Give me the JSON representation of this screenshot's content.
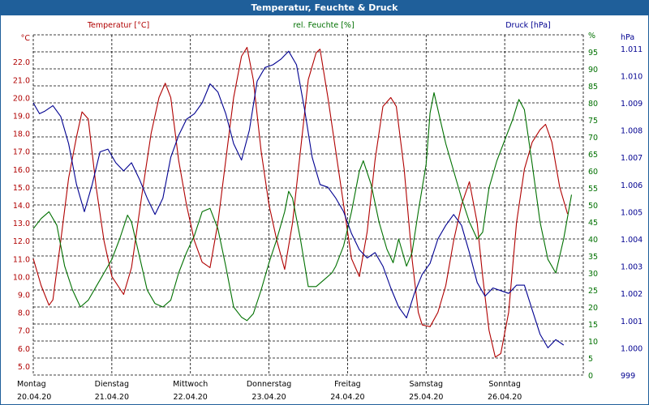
{
  "window": {
    "title": "Temperatur, Feuchte & Druck"
  },
  "colors": {
    "titlebar": "#1f5f9a",
    "temperature": "#b00000",
    "humidity": "#007000",
    "pressure": "#000090",
    "grid": "#000000"
  },
  "chart_data": {
    "type": "line",
    "title": "Temperatur, Feuchte & Druck",
    "grid": true,
    "x_days": [
      {
        "day": "Montag",
        "date": "20.04.20"
      },
      {
        "day": "Dienstag",
        "date": "21.04.20"
      },
      {
        "day": "Mittwoch",
        "date": "22.04.20"
      },
      {
        "day": "Donnerstag",
        "date": "23.04.20"
      },
      {
        "day": "Freitag",
        "date": "24.04.20"
      },
      {
        "day": "Samstag",
        "date": "25.04.20"
      },
      {
        "day": "Sonntag",
        "date": "26.04.20"
      }
    ],
    "axes": {
      "temperature": {
        "unit": "°C",
        "label": "Temperatur [°C]",
        "min": 4.5,
        "max": 23.5,
        "ticks": [
          "5.0",
          "6.0",
          "7.0",
          "8.0",
          "9.0",
          "10.0",
          "11.0",
          "12.0",
          "13.0",
          "14.0",
          "15.0",
          "16.0",
          "17.0",
          "18.0",
          "19.0",
          "20.0",
          "21.0",
          "22.0"
        ]
      },
      "humidity": {
        "unit": "%",
        "label": "rel. Feuchte [%]",
        "min": 0,
        "max": 100,
        "ticks": [
          "0",
          "5",
          "10",
          "15",
          "20",
          "25",
          "30",
          "35",
          "40",
          "45",
          "50",
          "55",
          "60",
          "65",
          "70",
          "75",
          "80",
          "85",
          "90",
          "95",
          "%"
        ]
      },
      "pressure": {
        "unit": "hPa",
        "label": "Druck [hPa]",
        "min": 999,
        "max": 1011.5,
        "ticks": [
          "999",
          "1.000",
          "1.001",
          "1.002",
          "1.003",
          "1.004",
          "1.005",
          "1.006",
          "1.007",
          "1.008",
          "1.009",
          "1.010",
          "1.011"
        ]
      }
    },
    "series": [
      {
        "name": "Temperatur [°C]",
        "axis": "temperature",
        "points": [
          [
            0,
            11
          ],
          [
            0.1,
            9.5
          ],
          [
            0.2,
            8.4
          ],
          [
            0.25,
            8.7
          ],
          [
            0.35,
            12
          ],
          [
            0.45,
            15.5
          ],
          [
            0.55,
            17.8
          ],
          [
            0.62,
            19.2
          ],
          [
            0.7,
            18.8
          ],
          [
            0.8,
            15
          ],
          [
            0.9,
            12
          ],
          [
            1,
            10
          ],
          [
            1.15,
            9
          ],
          [
            1.25,
            10.5
          ],
          [
            1.38,
            14.5
          ],
          [
            1.5,
            18
          ],
          [
            1.6,
            20
          ],
          [
            1.68,
            20.8
          ],
          [
            1.75,
            20
          ],
          [
            1.85,
            16.5
          ],
          [
            1.95,
            14
          ],
          [
            2.05,
            12
          ],
          [
            2.15,
            10.8
          ],
          [
            2.25,
            10.5
          ],
          [
            2.35,
            13
          ],
          [
            2.45,
            16.5
          ],
          [
            2.55,
            20
          ],
          [
            2.65,
            22.3
          ],
          [
            2.72,
            22.8
          ],
          [
            2.8,
            21
          ],
          [
            2.9,
            17
          ],
          [
            3.0,
            14
          ],
          [
            3.1,
            12
          ],
          [
            3.2,
            10.4
          ],
          [
            3.3,
            13
          ],
          [
            3.4,
            17
          ],
          [
            3.5,
            21
          ],
          [
            3.6,
            22.5
          ],
          [
            3.65,
            22.7
          ],
          [
            3.75,
            20
          ],
          [
            3.85,
            17
          ],
          [
            3.95,
            14
          ],
          [
            4.05,
            11
          ],
          [
            4.15,
            10
          ],
          [
            4.25,
            12.5
          ],
          [
            4.35,
            16.5
          ],
          [
            4.45,
            19.5
          ],
          [
            4.55,
            20
          ],
          [
            4.62,
            19.5
          ],
          [
            4.72,
            16
          ],
          [
            4.82,
            11
          ],
          [
            4.9,
            8
          ],
          [
            4.95,
            7.3
          ],
          [
            5.05,
            7.2
          ],
          [
            5.15,
            8
          ],
          [
            5.25,
            9.5
          ],
          [
            5.35,
            12
          ],
          [
            5.45,
            14
          ],
          [
            5.55,
            15.3
          ],
          [
            5.65,
            13
          ],
          [
            5.72,
            10
          ],
          [
            5.8,
            7
          ],
          [
            5.88,
            5.5
          ],
          [
            5.95,
            5.7
          ],
          [
            6.05,
            8
          ],
          [
            6.15,
            13
          ],
          [
            6.25,
            16
          ],
          [
            6.35,
            17.5
          ],
          [
            6.45,
            18.2
          ],
          [
            6.52,
            18.5
          ],
          [
            6.6,
            17.5
          ],
          [
            6.7,
            15
          ],
          [
            6.8,
            13.5
          ]
        ]
      },
      {
        "name": "rel. Feuchte [%]",
        "axis": "humidity",
        "points": [
          [
            0,
            43
          ],
          [
            0.1,
            46
          ],
          [
            0.2,
            48
          ],
          [
            0.3,
            44
          ],
          [
            0.4,
            32
          ],
          [
            0.5,
            25
          ],
          [
            0.6,
            20
          ],
          [
            0.7,
            22
          ],
          [
            0.8,
            26
          ],
          [
            0.9,
            30
          ],
          [
            1,
            34
          ],
          [
            1.1,
            40
          ],
          [
            1.2,
            47
          ],
          [
            1.25,
            45
          ],
          [
            1.35,
            35
          ],
          [
            1.45,
            25
          ],
          [
            1.55,
            21
          ],
          [
            1.65,
            20
          ],
          [
            1.75,
            22
          ],
          [
            1.85,
            30
          ],
          [
            1.95,
            36
          ],
          [
            2.05,
            41
          ],
          [
            2.15,
            48
          ],
          [
            2.25,
            49
          ],
          [
            2.35,
            43
          ],
          [
            2.45,
            32
          ],
          [
            2.55,
            20
          ],
          [
            2.65,
            17
          ],
          [
            2.72,
            16
          ],
          [
            2.8,
            18
          ],
          [
            2.9,
            25
          ],
          [
            3.0,
            33
          ],
          [
            3.1,
            40
          ],
          [
            3.2,
            48
          ],
          [
            3.25,
            54
          ],
          [
            3.3,
            52
          ],
          [
            3.4,
            40
          ],
          [
            3.5,
            26
          ],
          [
            3.6,
            26
          ],
          [
            3.7,
            28
          ],
          [
            3.8,
            30
          ],
          [
            3.85,
            32
          ],
          [
            3.95,
            38
          ],
          [
            4.05,
            48
          ],
          [
            4.15,
            60
          ],
          [
            4.2,
            63
          ],
          [
            4.3,
            56
          ],
          [
            4.4,
            45
          ],
          [
            4.5,
            37
          ],
          [
            4.58,
            33
          ],
          [
            4.65,
            40
          ],
          [
            4.75,
            32
          ],
          [
            4.82,
            36
          ],
          [
            4.9,
            48
          ],
          [
            5.0,
            62
          ],
          [
            5.05,
            77
          ],
          [
            5.1,
            83
          ],
          [
            5.18,
            75
          ],
          [
            5.25,
            68
          ],
          [
            5.35,
            60
          ],
          [
            5.45,
            52
          ],
          [
            5.55,
            45
          ],
          [
            5.65,
            40
          ],
          [
            5.72,
            42
          ],
          [
            5.8,
            55
          ],
          [
            5.9,
            63
          ],
          [
            6.0,
            69
          ],
          [
            6.1,
            75
          ],
          [
            6.18,
            81
          ],
          [
            6.25,
            78
          ],
          [
            6.35,
            62
          ],
          [
            6.45,
            45
          ],
          [
            6.55,
            34
          ],
          [
            6.65,
            30
          ],
          [
            6.75,
            40
          ],
          [
            6.85,
            53
          ]
        ]
      },
      {
        "name": "Druck [hPa]",
        "axis": "pressure",
        "points": [
          [
            0,
            1009
          ],
          [
            0.08,
            1008.6
          ],
          [
            0.15,
            1008.7
          ],
          [
            0.25,
            1008.9
          ],
          [
            0.35,
            1008.5
          ],
          [
            0.45,
            1007.5
          ],
          [
            0.55,
            1006
          ],
          [
            0.65,
            1005
          ],
          [
            0.75,
            1006
          ],
          [
            0.85,
            1007.2
          ],
          [
            0.95,
            1007.3
          ],
          [
            1.05,
            1006.8
          ],
          [
            1.15,
            1006.5
          ],
          [
            1.25,
            1006.8
          ],
          [
            1.35,
            1006.2
          ],
          [
            1.45,
            1005.5
          ],
          [
            1.55,
            1004.9
          ],
          [
            1.65,
            1005.5
          ],
          [
            1.75,
            1007
          ],
          [
            1.85,
            1007.8
          ],
          [
            1.95,
            1008.4
          ],
          [
            2.05,
            1008.6
          ],
          [
            2.15,
            1009
          ],
          [
            2.25,
            1009.7
          ],
          [
            2.35,
            1009.4
          ],
          [
            2.45,
            1008.6
          ],
          [
            2.55,
            1007.5
          ],
          [
            2.65,
            1006.9
          ],
          [
            2.75,
            1008
          ],
          [
            2.85,
            1009.8
          ],
          [
            2.95,
            1010.3
          ],
          [
            3.05,
            1010.4
          ],
          [
            3.15,
            1010.6
          ],
          [
            3.25,
            1010.9
          ],
          [
            3.35,
            1010.4
          ],
          [
            3.45,
            1008.8
          ],
          [
            3.55,
            1007
          ],
          [
            3.65,
            1006
          ],
          [
            3.75,
            1005.9
          ],
          [
            3.85,
            1005.5
          ],
          [
            3.95,
            1005
          ],
          [
            4.05,
            1004.2
          ],
          [
            4.15,
            1003.6
          ],
          [
            4.25,
            1003.3
          ],
          [
            4.35,
            1003.5
          ],
          [
            4.45,
            1003
          ],
          [
            4.55,
            1002.2
          ],
          [
            4.65,
            1001.5
          ],
          [
            4.75,
            1001.1
          ],
          [
            4.85,
            1002
          ],
          [
            4.95,
            1002.7
          ],
          [
            5.05,
            1003.1
          ],
          [
            5.15,
            1004
          ],
          [
            5.25,
            1004.5
          ],
          [
            5.35,
            1004.9
          ],
          [
            5.45,
            1004.5
          ],
          [
            5.55,
            1003.5
          ],
          [
            5.65,
            1002.4
          ],
          [
            5.75,
            1001.9
          ],
          [
            5.85,
            1002.2
          ],
          [
            5.95,
            1002.1
          ],
          [
            6.05,
            1002
          ],
          [
            6.15,
            1002.3
          ],
          [
            6.25,
            1002.3
          ],
          [
            6.35,
            1001.4
          ],
          [
            6.45,
            1000.5
          ],
          [
            6.55,
            1000
          ],
          [
            6.65,
            1000.3
          ],
          [
            6.75,
            1000.1
          ]
        ]
      }
    ]
  }
}
